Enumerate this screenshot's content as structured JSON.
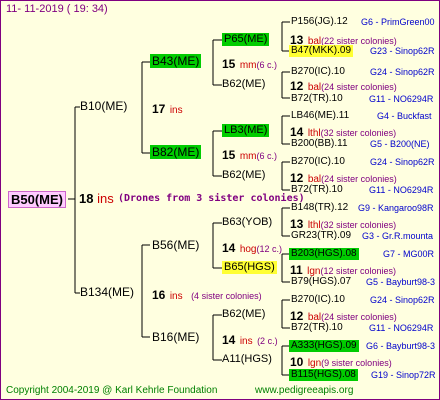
{
  "header": {
    "date": "11- 11-2019 ( 19: 34)"
  },
  "footer": {
    "copyright": "Copyright 2004-2019 @ Karl Kehrle Foundation",
    "website": "www.pedigreeapis.org"
  },
  "root": {
    "name": "B50(ME)",
    "num": "18",
    "unit": "ins",
    "drones": "(Drones from 3 sister colonies)"
  },
  "parents": {
    "top": {
      "name": "B10(ME)",
      "num": "17",
      "unit": "ins"
    },
    "bottom": {
      "name": "B134(ME)",
      "num": "16",
      "unit": "ins",
      "sub": "(4 sister colonies)"
    }
  },
  "gp": {
    "b43": {
      "name": "B43(ME)",
      "num": "15",
      "unit": "mm",
      "sub": "(6 c.)"
    },
    "b82": {
      "name": "B82(ME)",
      "num": "15",
      "unit": "mm",
      "sub": "(6 c.)"
    },
    "b56": {
      "name": "B56(ME)",
      "num": "14",
      "unit": "hog",
      "sub": "(12 c.)"
    },
    "b16": {
      "name": "B16(ME)",
      "num": "14",
      "unit": "ins",
      "sub": "(2 c.)"
    }
  },
  "ggp": {
    "p65": {
      "name": "P65(ME)",
      "num": "13",
      "unit": "bal",
      "sub": "(22 sister colonies)"
    },
    "b62a": {
      "name": "B62(ME)",
      "num": "12",
      "unit": "bal",
      "sub": "(24 sister colonies)"
    },
    "lb3": {
      "name": "LB3(ME)",
      "num": "14",
      "unit": "lthl",
      "sub": "(32 sister colonies)"
    },
    "b62b": {
      "name": "B62(ME)",
      "num": "12",
      "unit": "bal",
      "sub": "(24 sister colonies)"
    },
    "b63": {
      "name": "B63(YOB)",
      "num": "13",
      "unit": "lthl",
      "sub": "(32 sister colonies)"
    },
    "b65": {
      "name": "B65(HGS)",
      "num": "11",
      "unit": "lgn",
      "sub": "(12 sister colonies)"
    },
    "b62c": {
      "name": "B62(ME)",
      "num": "12",
      "unit": "bal",
      "sub": "(24 sister colonies)"
    },
    "a11": {
      "name": "A11(HGS)",
      "num": "10",
      "unit": "lgn",
      "sub": "(9 sister colonies)"
    }
  },
  "leaves": [
    {
      "name": "P156(JG).12",
      "info": "G6 - PrimGreen00"
    },
    {
      "name": "B47(MKK).09",
      "info": "G23 - Sinop62R"
    },
    {
      "name": "B270(IC).10",
      "info": "G24 - Sinop62R"
    },
    {
      "name": "B72(TR).10",
      "info": "G11 - NO6294R"
    },
    {
      "name": "LB46(ME).11",
      "info": "G4 - Buckfast"
    },
    {
      "name": "B200(BB).11",
      "info": "G5 - B200(NE)"
    },
    {
      "name": "B270(IC).10",
      "info": "G24 - Sinop62R"
    },
    {
      "name": "B72(TR).10",
      "info": "G11 - NO6294R"
    },
    {
      "name": "B148(TR).12",
      "info": "G9 - Kangaroo98R"
    },
    {
      "name": "GR23(TR).09",
      "info": "G3 - Gr.R.mounta"
    },
    {
      "name": "B203(HGS).08",
      "info": "G7 - MG00R"
    },
    {
      "name": "B79(HGS).07",
      "info": "G5 - Bayburt98-3"
    },
    {
      "name": "B270(IC).10",
      "info": "G24 - Sinop62R"
    },
    {
      "name": "B72(TR).10",
      "info": "G11 - NO6294R"
    },
    {
      "name": "A333(HGS).09",
      "info": "G6 - Bayburt98-3"
    },
    {
      "name": "B115(HGS).08",
      "info": "G19 - Sinop72R"
    }
  ]
}
